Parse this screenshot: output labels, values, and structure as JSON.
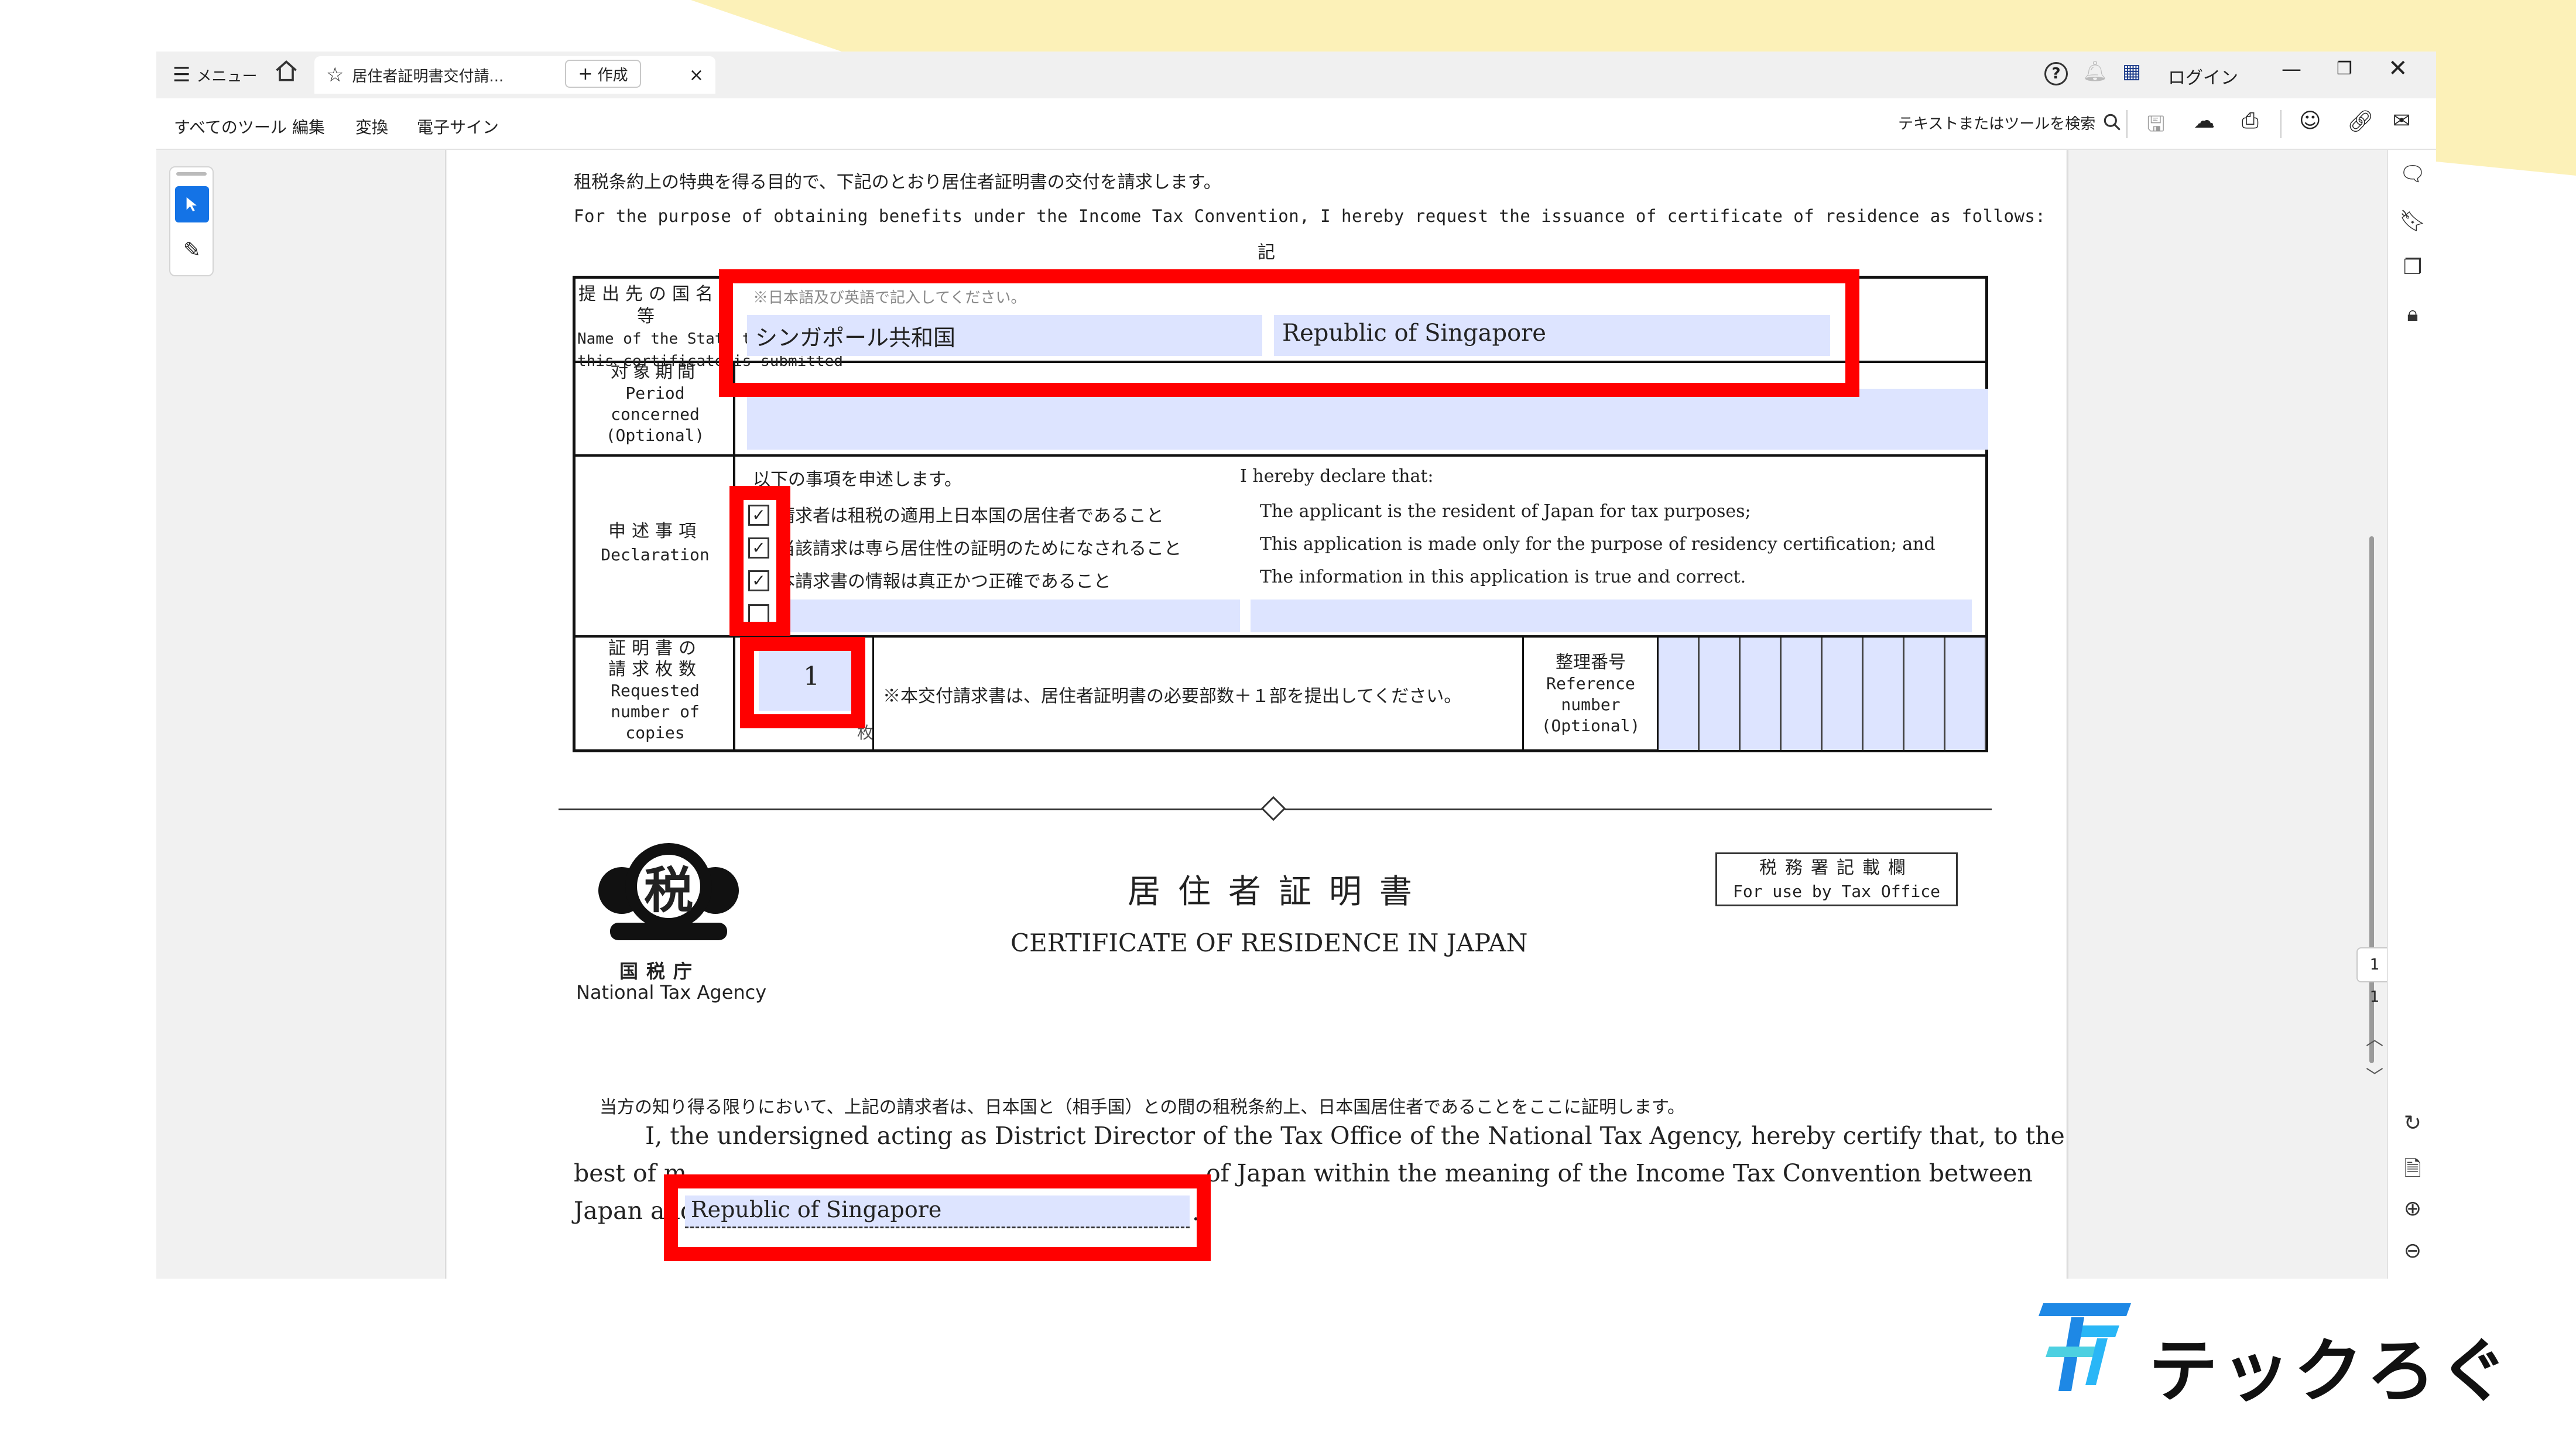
{
  "window": {
    "menu_label": "メニュー",
    "tab_title": "居住者証明書交付請...",
    "create_label": "作成",
    "login_label": "ログイン"
  },
  "toolbar": {
    "all_tools": "すべてのツール",
    "edit": "編集",
    "convert": "変換",
    "esign": "電子サイン",
    "search_placeholder": "テキストまたはツールを検索"
  },
  "document": {
    "intro_ja": "租税条約上の特典を得る目的で、下記のとおり居住者証明書の交付を請求します。",
    "intro_en": "For the purpose of obtaining benefits under the Income Tax Convention, I hereby request the issuance of certificate of residence as follows:",
    "ki": "記",
    "row1_label_ja": "提出先の国名等",
    "row1_label_en_1": "Name of the State to which",
    "row1_label_en_2": "this certificate is submitted",
    "row1_note": "※日本語及び英語で記入してください。",
    "country_ja": "シンガポール共和国",
    "country_en": "Republic of Singapore",
    "row2_label_ja": "対象期間",
    "row2_label_en_1": "Period",
    "row2_label_en_2": "concerned",
    "row2_label_en_3": "(Optional)",
    "row2_value": "",
    "row3_label_ja": "申述事項",
    "row3_label_en": "Declaration",
    "decl_header_ja": "以下の事項を申述します。",
    "decl_header_en": "I hereby declare that:",
    "declarations": [
      {
        "ja": "請求者は租税の適用上日本国の居住者であること",
        "en": "The applicant is the resident of Japan for tax purposes;",
        "checked": true
      },
      {
        "ja": "当該請求は専ら居住性の証明のためになされること",
        "en": "This application is made only for the purpose of residency certification; and",
        "checked": true
      },
      {
        "ja": "本請求書の情報は真正かつ正確であること",
        "en": "The information in this application is true and correct.",
        "checked": true
      },
      {
        "ja": "",
        "en": "",
        "checked": false
      }
    ],
    "row4_label_ja_1": "証明書の",
    "row4_label_ja_2": "請求枚数",
    "row4_label_en_1": "Requested",
    "row4_label_en_2": "number of",
    "row4_label_en_3": "copies",
    "copies_value": "1",
    "copies_unit": "枚",
    "copies_note": "※本交付請求書は、居住者証明書の必要部数＋１部を提出してください。",
    "ref_label_ja": "整理番号",
    "ref_label_en_1": "Reference",
    "ref_label_en_2": "number",
    "ref_label_en_3": "(Optional)",
    "logo_char": "税",
    "agency_ja": "国税庁",
    "agency_en": "National Tax Agency",
    "cert_title_ja": "居住者証明書",
    "cert_title_en": "CERTIFICATE OF RESIDENCE IN JAPAN",
    "tax_office_ja": "税務署記載欄",
    "tax_office_en": "For use by Tax Office",
    "cert_text_ja": "当方の知り得る限りにおいて、上記の請求者は、日本国と（相手国）との間の租税条約上、日本国居住者であることをここに証明します。",
    "cert_text_en_1": "I, the undersigned acting as District Director of the Tax Office of the National Tax Agency, hereby certify that, to the",
    "cert_text_en_2a": "best of m",
    "cert_text_en_2b": "of Japan within the meaning of the Income Tax Convention between",
    "cert_text_en_3a": "Japan and",
    "cert_country": "Republic of Singapore",
    "cert_end": "."
  },
  "pager": {
    "current_page": "1",
    "total_pages": "1"
  },
  "brand": {
    "name": "テックろぐ"
  },
  "colors": {
    "highlight_red": "#ff0000",
    "field_blue": "#dde4ff",
    "select_tool_blue": "#1473e6",
    "banner_yellow": "#fcf1b8"
  }
}
